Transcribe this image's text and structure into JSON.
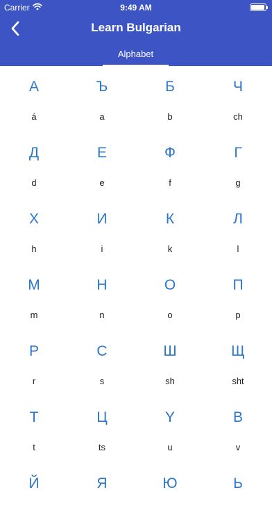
{
  "status_bar": {
    "carrier": "Carrier",
    "time": "9:49 AM",
    "wifi_icon": "wifi-icon",
    "battery_icon": "battery-icon"
  },
  "header": {
    "title": "Learn Bulgarian",
    "back_icon": "chevron-left-icon",
    "background_color": "#3c54c4"
  },
  "tabs": [
    {
      "label": "Alphabet",
      "selected": true
    }
  ],
  "colors": {
    "letter": "#2e77c8",
    "translit": "#222222"
  },
  "letters": [
    {
      "letter": "А",
      "translit": "á"
    },
    {
      "letter": "Ъ",
      "translit": "a"
    },
    {
      "letter": "Б",
      "translit": "b"
    },
    {
      "letter": "Ч",
      "translit": "ch"
    },
    {
      "letter": "Д",
      "translit": "d"
    },
    {
      "letter": "Е",
      "translit": "e"
    },
    {
      "letter": "Ф",
      "translit": "f"
    },
    {
      "letter": "Г",
      "translit": "g"
    },
    {
      "letter": "Х",
      "translit": "h"
    },
    {
      "letter": "И",
      "translit": "i"
    },
    {
      "letter": "К",
      "translit": "k"
    },
    {
      "letter": "Л",
      "translit": "l"
    },
    {
      "letter": "М",
      "translit": "m"
    },
    {
      "letter": "Н",
      "translit": "n"
    },
    {
      "letter": "О",
      "translit": "o"
    },
    {
      "letter": "П",
      "translit": "p"
    },
    {
      "letter": "Р",
      "translit": "r"
    },
    {
      "letter": "С",
      "translit": "s"
    },
    {
      "letter": "Ш",
      "translit": "sh"
    },
    {
      "letter": "Щ",
      "translit": "sht"
    },
    {
      "letter": "Т",
      "translit": "t"
    },
    {
      "letter": "Ц",
      "translit": "ts"
    },
    {
      "letter": "Y",
      "translit": "u"
    },
    {
      "letter": "В",
      "translit": "v"
    },
    {
      "letter": "Й",
      "translit": ""
    },
    {
      "letter": "Я",
      "translit": ""
    },
    {
      "letter": "Ю",
      "translit": ""
    },
    {
      "letter": "Ь",
      "translit": ""
    }
  ]
}
